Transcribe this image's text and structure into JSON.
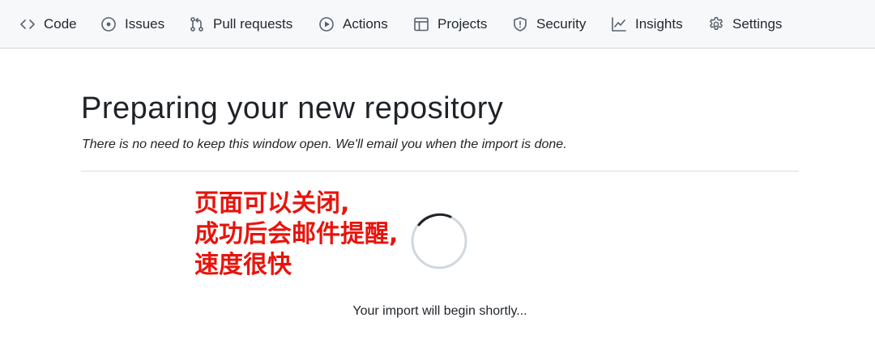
{
  "nav": {
    "items": [
      {
        "label": "Code",
        "icon": "code-icon"
      },
      {
        "label": "Issues",
        "icon": "issue-opened-icon"
      },
      {
        "label": "Pull requests",
        "icon": "git-pull-request-icon"
      },
      {
        "label": "Actions",
        "icon": "play-icon"
      },
      {
        "label": "Projects",
        "icon": "table-icon"
      },
      {
        "label": "Security",
        "icon": "shield-icon"
      },
      {
        "label": "Insights",
        "icon": "graph-icon"
      },
      {
        "label": "Settings",
        "icon": "gear-icon"
      }
    ]
  },
  "main": {
    "title": "Preparing your new repository",
    "subtitle": "There is no need to keep this window open. We'll email you when the import is done.",
    "annotation_lines": [
      "页面可以关闭,",
      "成功后会邮件提醒,",
      "速度很快"
    ],
    "annotation_color": "#e8140c",
    "status": "Your import will begin shortly..."
  }
}
